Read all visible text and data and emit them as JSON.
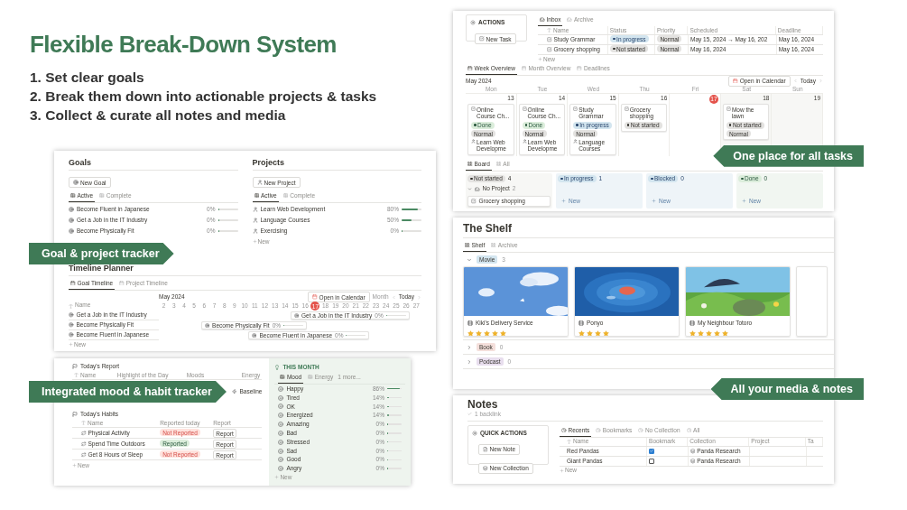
{
  "headline": "Flexible Break-Down System",
  "points": [
    "1. Set clear goals",
    "2. Break them down into actionable projects & tasks",
    "3. Collect & curate all notes and media"
  ],
  "goals_panel": {
    "callout": "Goal & project tracker",
    "goals": {
      "title": "Goals",
      "new_button": "New Goal",
      "tabs": [
        {
          "label": "Active",
          "selected": true
        },
        {
          "label": "Complete",
          "selected": false
        }
      ],
      "items": [
        {
          "name": "Become Fluent in Japanese",
          "percent": "0%",
          "level": 0
        },
        {
          "name": "Get a Job in the IT Industry",
          "percent": "0%",
          "level": 0
        },
        {
          "name": "Become Physically Fit",
          "percent": "0%",
          "level": 0
        }
      ]
    },
    "projects": {
      "title": "Projects",
      "new_button": "New Project",
      "tabs": [
        {
          "label": "Active",
          "selected": true
        },
        {
          "label": "Complete",
          "selected": false
        }
      ],
      "items": [
        {
          "name": "Learn Web Development",
          "percent": "80%",
          "level": 0.8
        },
        {
          "name": "Language Courses",
          "percent": "50%",
          "level": 0.5
        },
        {
          "name": "Exercising",
          "percent": "0%",
          "level": 0
        }
      ],
      "new_row": "New"
    },
    "timeline": {
      "title": "Timeline Planner",
      "tabs": [
        {
          "label": "Goal Timeline",
          "selected": true
        },
        {
          "label": "Project Timeline",
          "selected": false
        }
      ],
      "month": "May 2024",
      "open_calendar": "Open in Calendar",
      "range": "Month",
      "today": "Today",
      "name_column": "Name",
      "days": [
        {
          "label": "2",
          "today": false
        },
        {
          "label": "3",
          "today": false
        },
        {
          "label": "4",
          "today": false
        },
        {
          "label": "5",
          "today": false
        },
        {
          "label": "6",
          "today": false
        },
        {
          "label": "7",
          "today": false
        },
        {
          "label": "8",
          "today": false
        },
        {
          "label": "9",
          "today": false
        },
        {
          "label": "10",
          "today": false
        },
        {
          "label": "11",
          "today": false
        },
        {
          "label": "12",
          "today": false
        },
        {
          "label": "13",
          "today": false
        },
        {
          "label": "14",
          "today": false
        },
        {
          "label": "15",
          "today": false
        },
        {
          "label": "16",
          "today": false
        },
        {
          "label": "17",
          "today": true
        },
        {
          "label": "18",
          "today": false
        },
        {
          "label": "19",
          "today": false
        },
        {
          "label": "20",
          "today": false
        },
        {
          "label": "21",
          "today": false
        },
        {
          "label": "22",
          "today": false
        },
        {
          "label": "23",
          "today": false
        },
        {
          "label": "24",
          "today": false
        },
        {
          "label": "25",
          "today": false
        },
        {
          "label": "26",
          "today": false
        },
        {
          "label": "27",
          "today": false
        }
      ],
      "rows": [
        {
          "name": "Get a Job in the IT Industry",
          "bar_label": "Get a Job in the IT Industry",
          "percent": "0%",
          "level": 0
        },
        {
          "name": "Become Physically Fit",
          "bar_label": "Become Physically Fit",
          "percent": "0%",
          "level": 0
        },
        {
          "name": "Become Fluent in Japanese",
          "bar_label": "Become Fluent in Japanese",
          "percent": "0%",
          "level": 0
        }
      ],
      "new_row": "New"
    }
  },
  "mood_panel": {
    "callout": "Integrated mood & habit tracker",
    "report": {
      "title": "Today's Report",
      "columns": [
        "Name",
        "Highlight of the Day",
        "Moods",
        "Energy"
      ],
      "energy_value": "Baseline"
    },
    "habits": {
      "title": "Today's Habits",
      "columns": [
        "Name",
        "Reported today",
        "Report"
      ],
      "rows": [
        {
          "name": "Physical Activity",
          "status": "Not Reported",
          "reported": false,
          "button": "Report"
        },
        {
          "name": "Spend Time Outdoors",
          "status": "Reported",
          "reported": true,
          "button": "Report"
        },
        {
          "name": "Get 8 Hours of Sleep",
          "status": "Not Reported",
          "reported": false,
          "button": "Report"
        }
      ],
      "new_row": "New"
    },
    "this_month": {
      "title": "THIS MONTH",
      "tabs": [
        {
          "label": "Mood",
          "selected": true
        },
        {
          "label": "Energy",
          "selected": false
        }
      ],
      "more": "1 more...",
      "rows": [
        {
          "name": "Happy",
          "percent": "86%",
          "level": 0.86
        },
        {
          "name": "Tired",
          "percent": "14%",
          "level": 0.14
        },
        {
          "name": "OK",
          "percent": "14%",
          "level": 0.14
        },
        {
          "name": "Energized",
          "percent": "14%",
          "level": 0.14
        },
        {
          "name": "Amazing",
          "percent": "0%",
          "level": 0
        },
        {
          "name": "Bad",
          "percent": "0%",
          "level": 0
        },
        {
          "name": "Stressed",
          "percent": "0%",
          "level": 0
        },
        {
          "name": "Sad",
          "percent": "0%",
          "level": 0
        },
        {
          "name": "Good",
          "percent": "0%",
          "level": 0
        },
        {
          "name": "Angry",
          "percent": "0%",
          "level": 0
        }
      ],
      "new_row": "New"
    }
  },
  "tasks_panel": {
    "callout": "One place for all tasks",
    "actions": {
      "title": "ACTIONS",
      "button": "New Task"
    },
    "inbox": {
      "tabs": [
        {
          "label": "Inbox",
          "selected": true
        },
        {
          "label": "Archive",
          "selected": false
        }
      ],
      "columns": [
        "Name",
        "Status",
        "Priority",
        "Scheduled",
        "Deadline"
      ],
      "rows": [
        {
          "name": "Study Grammar",
          "status": "In progress",
          "kind": "in_progress",
          "priority": "Normal",
          "scheduled": "May 15, 2024 → May 16, 202",
          "deadline": "May 16, 2024"
        },
        {
          "name": "Grocery shopping",
          "status": "Not started",
          "kind": "not_started",
          "priority": "Normal",
          "scheduled": "May 16, 2024",
          "deadline": "May 16, 2024"
        }
      ],
      "new_row": "New"
    },
    "week": {
      "tabs": [
        {
          "label": "Week Overview",
          "selected": true
        },
        {
          "label": "Month Overview",
          "selected": false
        },
        {
          "label": "Deadlines",
          "selected": false
        }
      ],
      "month": "May 2024",
      "open_calendar": "Open in Calendar",
      "today": "Today",
      "days": [
        {
          "weekday": "Mon",
          "date": "13",
          "today": false,
          "tasks": [
            {
              "name": "Online Course Ch...",
              "status": "Done",
              "kind": "done",
              "priority": "Normal",
              "project": "Learn Web Developme"
            }
          ]
        },
        {
          "weekday": "Tue",
          "date": "14",
          "today": false,
          "tasks": [
            {
              "name": "Online Course Ch...",
              "status": "Done",
              "kind": "done",
              "priority": "Normal",
              "project": "Learn Web Developme"
            }
          ]
        },
        {
          "weekday": "Wed",
          "date": "15",
          "today": false,
          "tasks": [
            {
              "name": "Study Grammar",
              "status": "In progress",
              "kind": "in_progress",
              "priority": "Normal",
              "project": "Language Courses"
            }
          ]
        },
        {
          "weekday": "Thu",
          "date": "16",
          "today": false,
          "tasks": [
            {
              "name": "Grocery shopping",
              "status": "Not started",
              "kind": "not_started"
            }
          ]
        },
        {
          "weekday": "Fri",
          "date": "17",
          "today": true
        },
        {
          "weekday": "Sat",
          "date": "18",
          "today": false,
          "tasks": [
            {
              "name": "Mow the lawn",
              "status": "Not started",
              "kind": "not_started",
              "priority": "Normal"
            }
          ]
        },
        {
          "weekday": "Sun",
          "date": "19",
          "today": false
        }
      ]
    },
    "board": {
      "tabs": [
        {
          "label": "Board",
          "selected": true
        },
        {
          "label": "All",
          "selected": false
        }
      ],
      "columns": [
        {
          "label": "Not started",
          "kind": "not_started",
          "count": "4"
        },
        {
          "label": "In progress",
          "kind": "in_progress",
          "count": "1",
          "new_label": "New"
        },
        {
          "label": "Blocked",
          "kind": "blocked",
          "count": "0",
          "new_label": "New"
        },
        {
          "label": "Done",
          "kind": "done",
          "count": "0",
          "new_label": "New"
        }
      ],
      "group": {
        "name": "No Project",
        "count": "2",
        "expanded": true
      },
      "card": "Grocery shopping"
    }
  },
  "shelf_panel": {
    "callout": "All your media & notes",
    "title": "The Shelf",
    "tabs": [
      {
        "label": "Shelf",
        "selected": true
      },
      {
        "label": "Archive",
        "selected": false
      }
    ],
    "groups": [
      {
        "label": "Movie",
        "count": "3",
        "color": "#d3e5ef",
        "expanded": true,
        "items": [
          {
            "title": "Kiki's Delivery Service",
            "stars": 5
          },
          {
            "title": "Ponyo",
            "stars": 4
          },
          {
            "title": "My Neighbour Totoro",
            "stars": 5
          }
        ]
      },
      {
        "label": "Book",
        "count": "0",
        "color": "#f4dfdb",
        "expanded": false
      },
      {
        "label": "Podcast",
        "count": "0",
        "color": "#e8deee",
        "expanded": false
      }
    ]
  },
  "notes_panel": {
    "title": "Notes",
    "backlink": "1 backlink",
    "quick_actions": {
      "title": "QUICK ACTIONS",
      "buttons": [
        "New Note",
        "New Collection"
      ]
    },
    "tabs": [
      {
        "label": "Recents",
        "selected": true
      },
      {
        "label": "Bookmarks",
        "selected": false
      },
      {
        "label": "No Collection",
        "selected": false
      },
      {
        "label": "All",
        "selected": false
      }
    ],
    "columns": [
      "Name",
      "Bookmark",
      "Collection",
      "Project",
      "Ta"
    ],
    "rows": [
      {
        "name": "Red Pandas",
        "bookmarked": true,
        "collection": "Panda Research"
      },
      {
        "name": "Giant Pandas",
        "bookmarked": false,
        "collection": "Panda Research"
      }
    ],
    "new_row": "New"
  }
}
